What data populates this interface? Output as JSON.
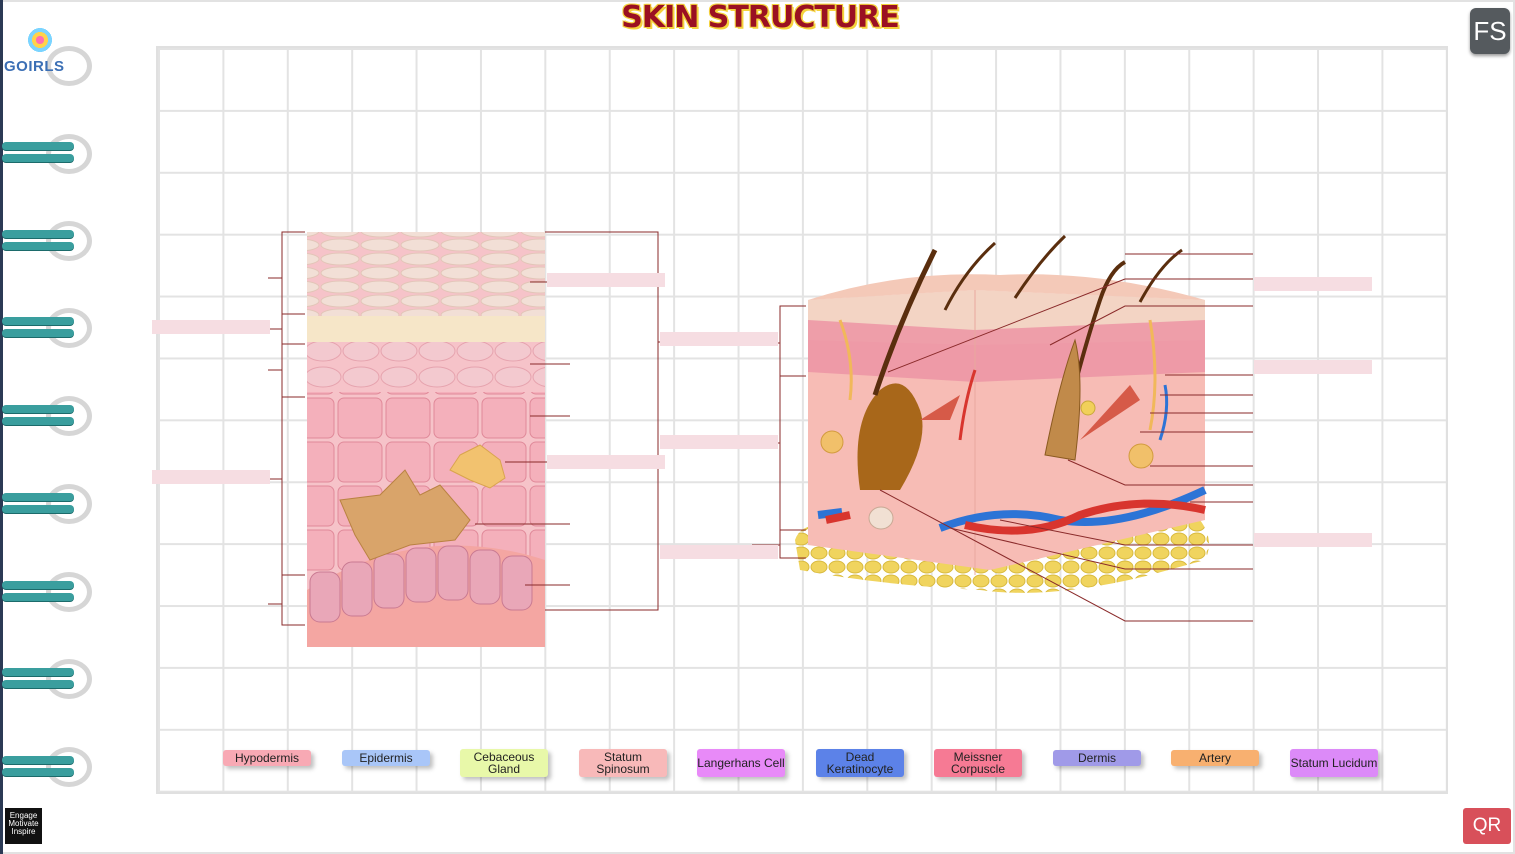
{
  "title": "SKIN STRUCTURE",
  "logo_text": "GOIRLS",
  "fullscreen_label": "FS",
  "qr_label": "QR",
  "badge_lines": [
    "Engage",
    "Motivate",
    "Inspire"
  ],
  "labels": [
    {
      "text": "Hypodermis",
      "color": "#f8a9b4"
    },
    {
      "text": "Epidermis",
      "color": "#a9c6f8"
    },
    {
      "text": "Cebaceous Gland",
      "color": "#e8f8a9"
    },
    {
      "text": "Statum Spinosum",
      "color": "#f8b9b9"
    },
    {
      "text": "Langerhans Cell",
      "color": "#e88af8"
    },
    {
      "text": "Dead Keratinocyte",
      "color": "#5c82e8"
    },
    {
      "text": "Meissner Corpuscle",
      "color": "#f67a94"
    },
    {
      "text": "Dermis",
      "color": "#a09ae8"
    },
    {
      "text": "Artery",
      "color": "#f8b070"
    },
    {
      "text": "Statum Lucidum",
      "color": "#dc8af8"
    }
  ]
}
